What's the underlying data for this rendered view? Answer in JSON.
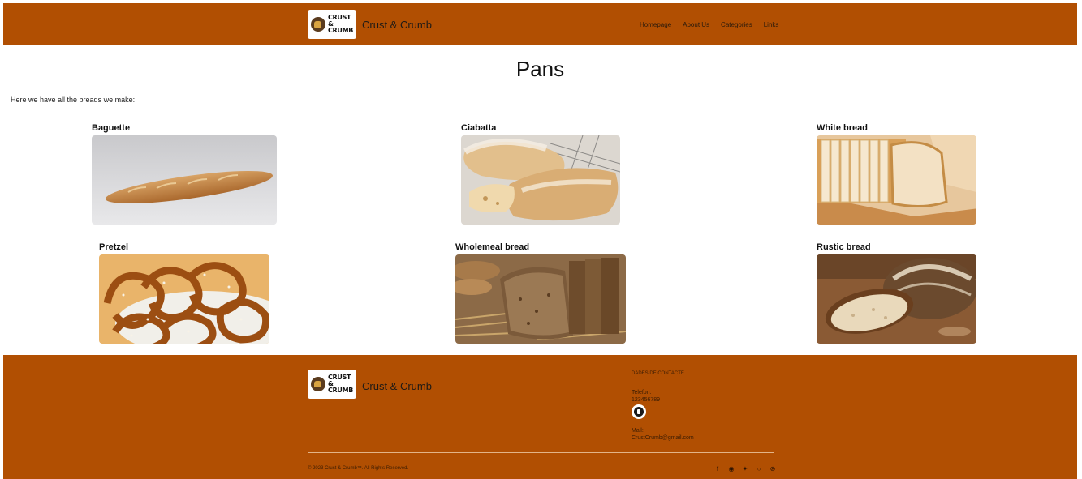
{
  "header": {
    "logo_text": [
      "CRUST",
      "&",
      "CRUMB"
    ],
    "brand_name": "Crust & Crumb",
    "nav": [
      "Homepage",
      "About Us",
      "Categories",
      "Links"
    ]
  },
  "main": {
    "title": "Pans",
    "intro": "Here we have all the breads we make:",
    "breads": [
      {
        "name": "Baguette",
        "icon": "baguette-photo"
      },
      {
        "name": "Ciabatta",
        "icon": "ciabatta-photo"
      },
      {
        "name": "White bread",
        "icon": "white-bread-photo"
      },
      {
        "name": "Pretzel",
        "icon": "pretzel-photo"
      },
      {
        "name": "Wholemeal bread",
        "icon": "wholemeal-bread-photo"
      },
      {
        "name": "Rustic bread",
        "icon": "rustic-bread-photo"
      }
    ]
  },
  "footer": {
    "brand_name": "Crust & Crumb",
    "contact_title": "DADES DE CONTACTE",
    "phone_label": "Telefon:",
    "phone_value": "123456789",
    "mail_label": "Mail:",
    "mail_value": "CrustCrumb@gmail.com",
    "copyright": "© 2023 Crust & Crumb™. All Rights Reserved.",
    "socials": [
      "facebook-icon",
      "discord-icon",
      "twitter-icon",
      "github-icon",
      "dribbble-icon"
    ]
  },
  "colors": {
    "brand_orange": "#b14f02",
    "background": "#ffffff"
  }
}
